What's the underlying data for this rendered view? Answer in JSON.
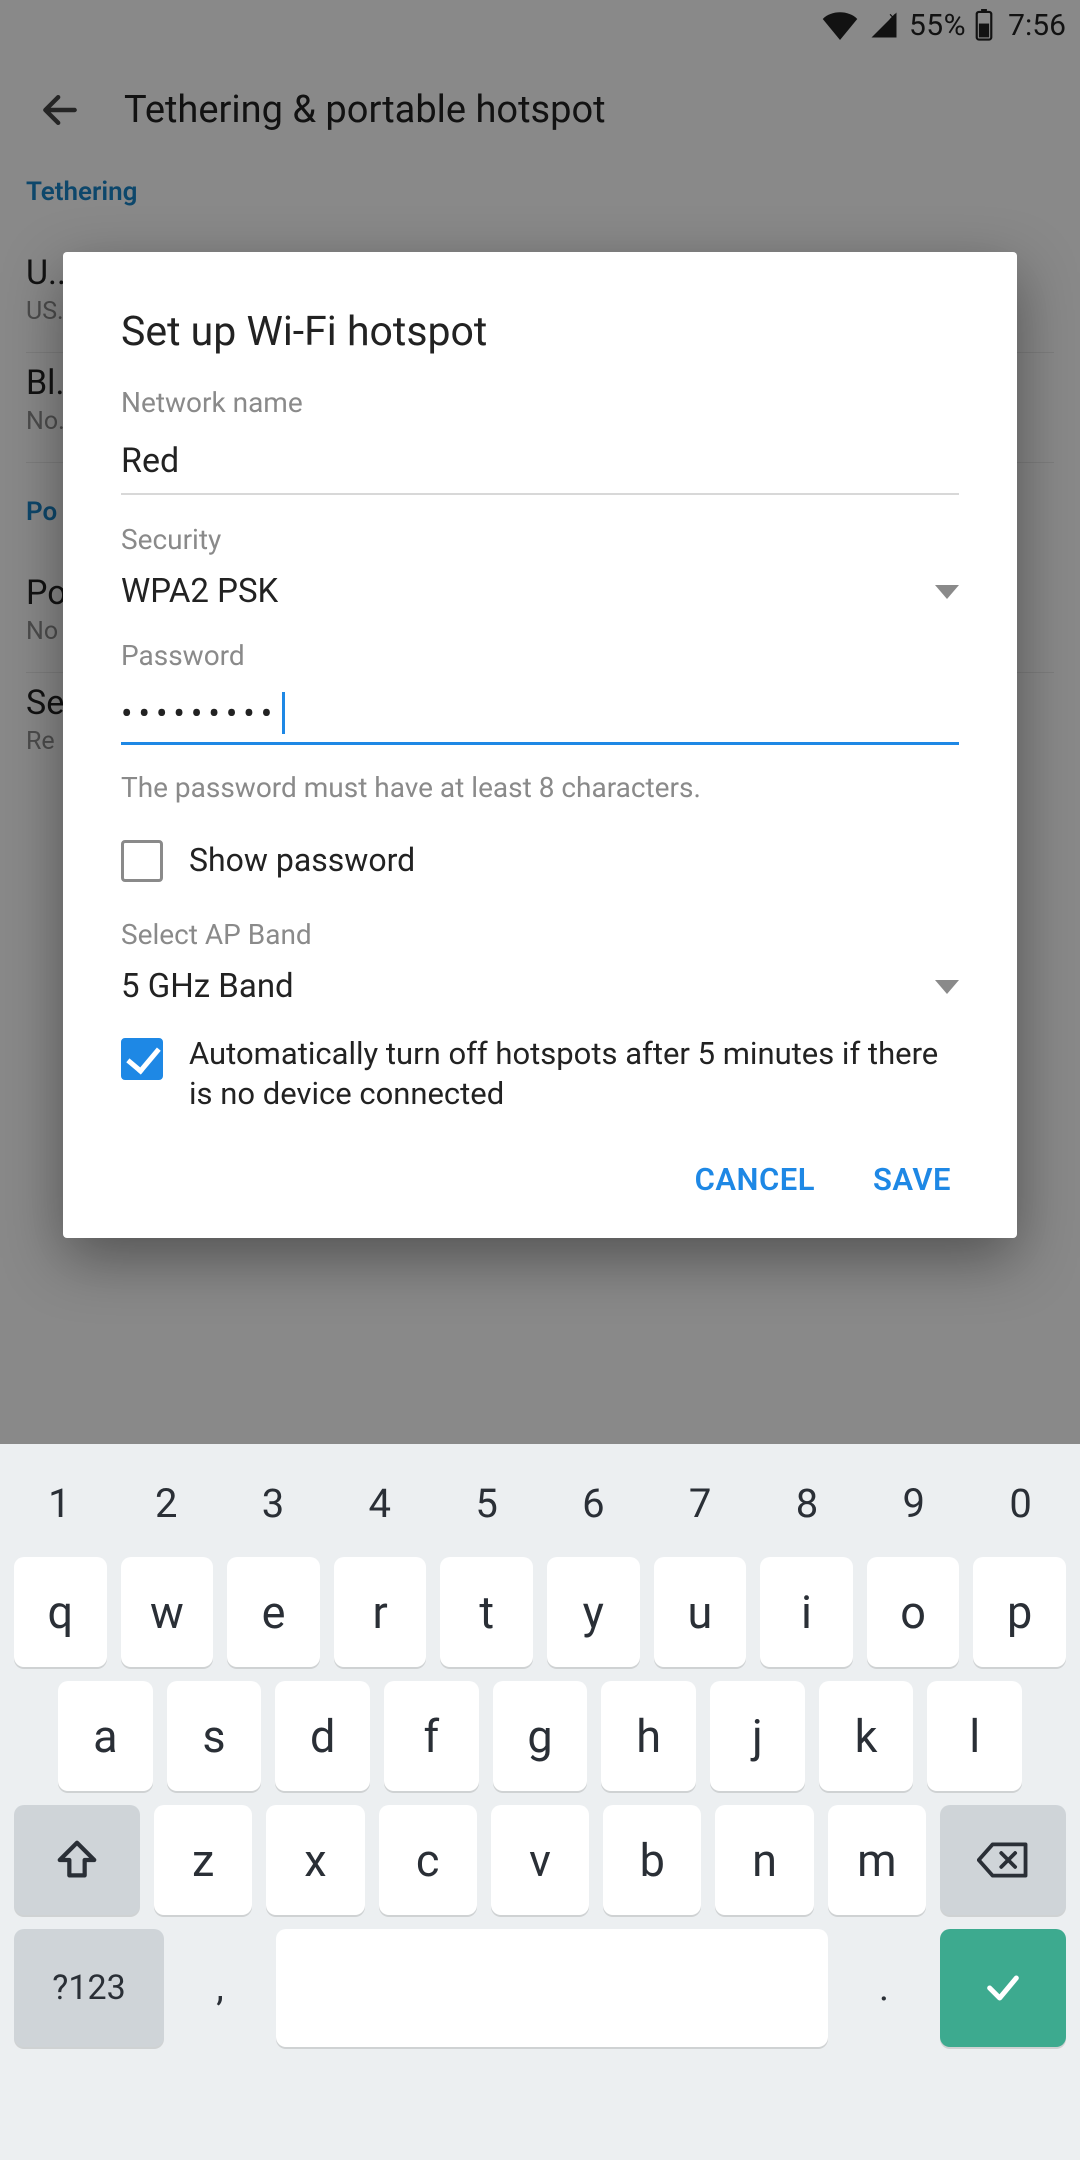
{
  "status": {
    "battery_pct": "55%",
    "time": "7:56"
  },
  "toolbar": {
    "title": "Tethering & portable hotspot"
  },
  "bg": {
    "section1_label": "Tethering",
    "item1_title": "U...",
    "item1_sub": "US...",
    "item2_title": "Bl...",
    "item2_sub": "No...",
    "section2_label": "Po",
    "item3_title": "Po",
    "item3_sub": "No",
    "item4_title": "Se",
    "item4_sub": "Re"
  },
  "dialog": {
    "title": "Set up Wi-Fi hotspot",
    "network_name_label": "Network name",
    "network_name_value": "Red",
    "security_label": "Security",
    "security_value": "WPA2 PSK",
    "password_label": "Password",
    "password_mask": "•••••••••",
    "password_hint": "The password must have at least 8 characters.",
    "show_password_label": "Show password",
    "ap_band_label": "Select AP Band",
    "ap_band_value": "5 GHz Band",
    "auto_off_label": "Automatically turn off hotspots after 5 minutes if there is no device connected",
    "cancel": "CANCEL",
    "save": "SAVE"
  },
  "keyboard": {
    "nums": [
      "1",
      "2",
      "3",
      "4",
      "5",
      "6",
      "7",
      "8",
      "9",
      "0"
    ],
    "row1": [
      "q",
      "w",
      "e",
      "r",
      "t",
      "y",
      "u",
      "i",
      "o",
      "p"
    ],
    "row2": [
      "a",
      "s",
      "d",
      "f",
      "g",
      "h",
      "j",
      "k",
      "l"
    ],
    "row3": [
      "z",
      "x",
      "c",
      "v",
      "b",
      "n",
      "m"
    ],
    "sym": "?123",
    "comma": ",",
    "dot": "."
  }
}
